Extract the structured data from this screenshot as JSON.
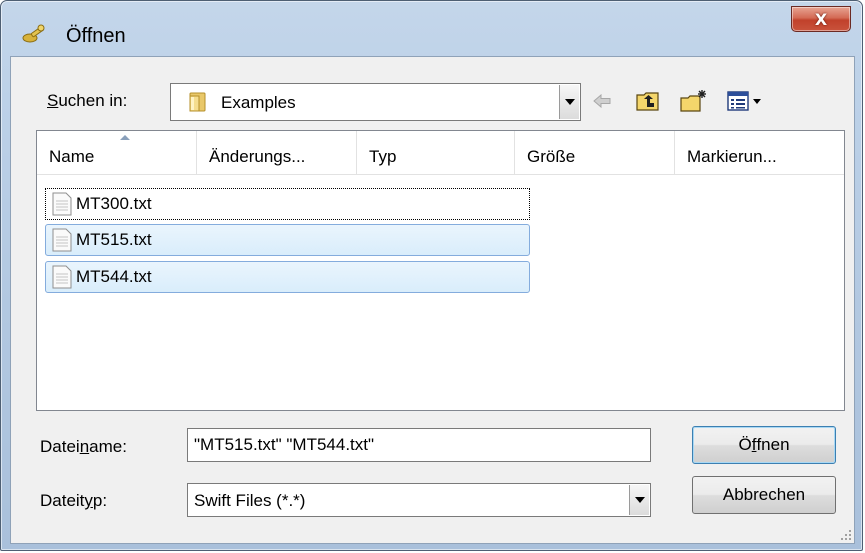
{
  "window": {
    "title": "Öffnen",
    "icon": "open-folder-key-icon",
    "close_label": "X"
  },
  "lookin": {
    "label_pre": "",
    "label_accel": "S",
    "label_post": "uchen in:",
    "value": "Examples",
    "folder_icon": "folder-icon"
  },
  "toolbar": {
    "back_icon": "back-arrow-icon",
    "up_icon": "up-one-level-icon",
    "new_folder_icon": "new-folder-icon",
    "view_menu_icon": "view-menu-icon"
  },
  "list": {
    "columns": [
      "Name",
      "Änderungs...",
      "Typ",
      "Größe",
      "Markierun..."
    ],
    "files": [
      {
        "name": "MT300.txt",
        "state": "focus"
      },
      {
        "name": "MT515.txt",
        "state": "selected"
      },
      {
        "name": "MT544.txt",
        "state": "selected"
      }
    ]
  },
  "filename": {
    "label_pre": "Datei",
    "label_accel": "n",
    "label_post": "ame:",
    "value": "\"MT515.txt\" \"MT544.txt\""
  },
  "filetype": {
    "label_pre": "Dateit",
    "label_accel": "y",
    "label_post": "p:",
    "value": "Swift Files (*.*)"
  },
  "buttons": {
    "open_pre": "Ö",
    "open_accel": "f",
    "open_post": "fnen",
    "cancel": "Abbrechen"
  },
  "colors": {
    "selection_fill": "#d9edfb",
    "selection_border": "#84acdd",
    "close_button": "#c1412b"
  }
}
